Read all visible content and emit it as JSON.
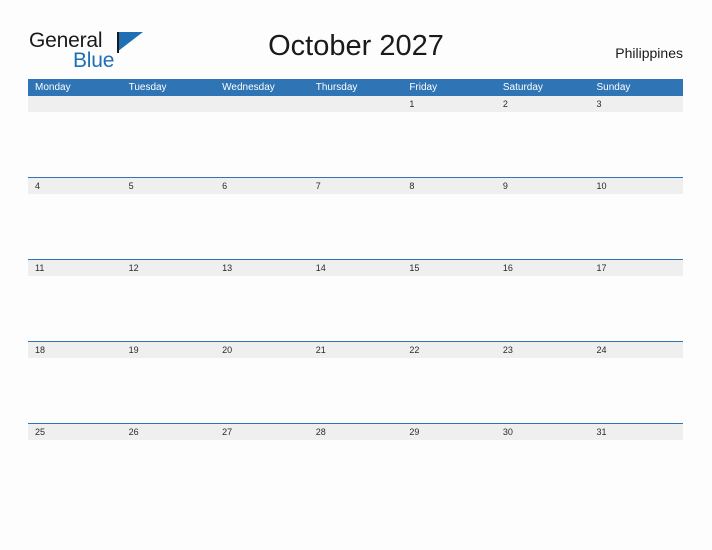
{
  "brand": {
    "word_one": "General",
    "word_two": "Blue",
    "flag_icon": "blue-triangle-flag-icon",
    "accent_color": "#1f6fb5"
  },
  "header": {
    "title": "October 2027",
    "country": "Philippines"
  },
  "colors": {
    "header_band": "#2f74b5",
    "date_band": "#efefef",
    "page_background": "#fdfdfd",
    "text": "#1a1a1a",
    "header_text": "#ffffff"
  },
  "calendar": {
    "month": "October",
    "year": "2027",
    "weekday_headers": [
      "Monday",
      "Tuesday",
      "Wednesday",
      "Thursday",
      "Friday",
      "Saturday",
      "Sunday"
    ],
    "weeks": [
      {
        "days": [
          "",
          "",
          "",
          "",
          "1",
          "2",
          "3"
        ]
      },
      {
        "days": [
          "4",
          "5",
          "6",
          "7",
          "8",
          "9",
          "10"
        ]
      },
      {
        "days": [
          "11",
          "12",
          "13",
          "14",
          "15",
          "16",
          "17"
        ]
      },
      {
        "days": [
          "18",
          "19",
          "20",
          "21",
          "22",
          "23",
          "24"
        ]
      },
      {
        "days": [
          "25",
          "26",
          "27",
          "28",
          "29",
          "30",
          "31"
        ]
      }
    ]
  }
}
